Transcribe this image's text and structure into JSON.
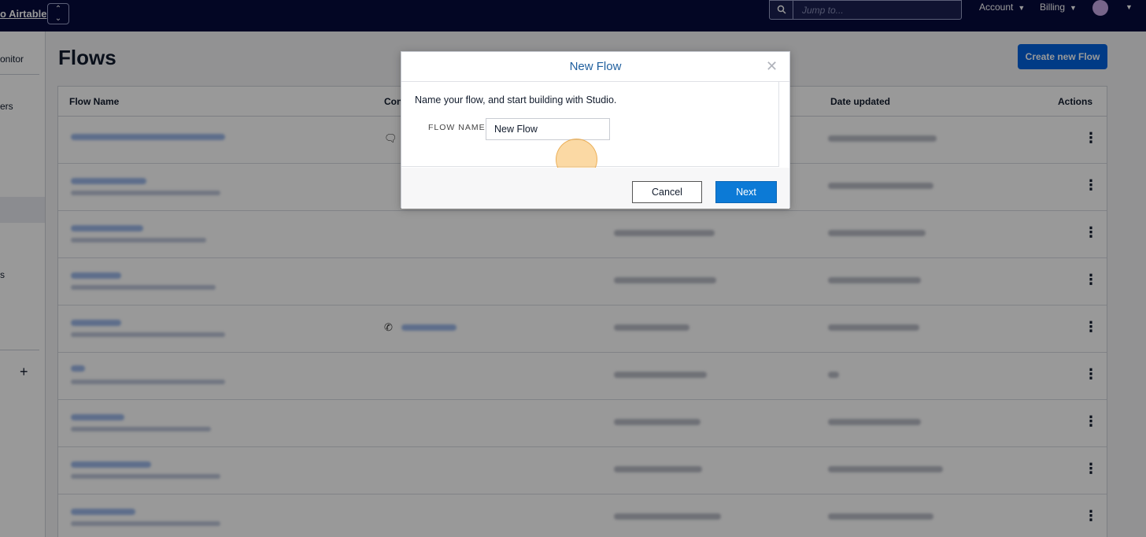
{
  "topbar": {
    "workspace_name": "o Airtable",
    "workspace_switch_icon": "chevron-updown-icon",
    "search_placeholder": "Jump to...",
    "menu_account": "Account",
    "menu_billing": "Billing"
  },
  "sidebar": {
    "items": [
      "onitor",
      "ers",
      "s"
    ]
  },
  "main": {
    "title": "Flows",
    "create_button": "Create new Flow",
    "columns": [
      "Flow Name",
      "Con",
      "Date updated",
      "Actions"
    ]
  },
  "modal": {
    "title": "New Flow",
    "description": "Name your flow, and start building with Studio.",
    "field_label": "FLOW NAME",
    "field_value": "New Flow",
    "cancel_label": "Cancel",
    "next_label": "Next"
  },
  "colors": {
    "topbar": "#060a3d",
    "primary_button": "#0263e0",
    "modal_title": "#1f5f9e",
    "next_button": "#0c7ad6"
  }
}
